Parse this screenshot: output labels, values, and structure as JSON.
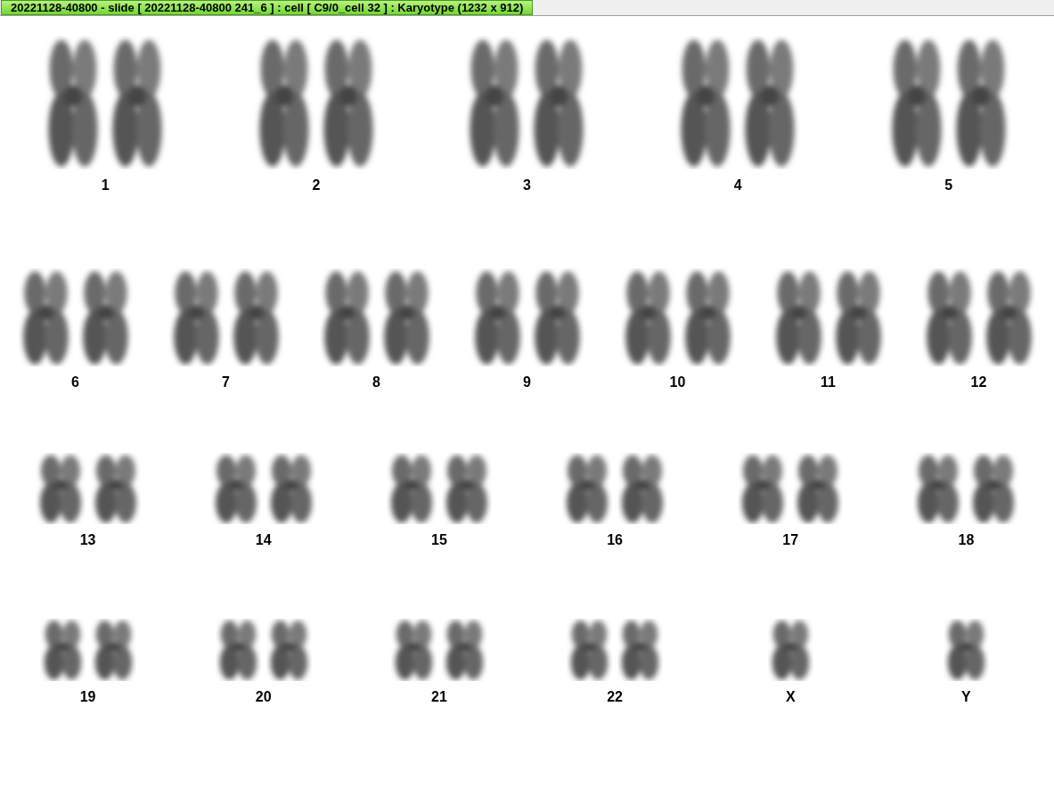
{
  "window": {
    "title": "20221128-40800 - slide [ 20221128-40800 241_6 ] : cell [ C9/0_cell 32 ] : Karyotype  (1232 x 912)"
  },
  "karyotype": {
    "rows": [
      {
        "kind": "large",
        "groups": [
          {
            "label": "1",
            "kind": "pair"
          },
          {
            "label": "2",
            "kind": "pair"
          },
          {
            "label": "3",
            "kind": "pair"
          },
          {
            "label": "4",
            "kind": "pair"
          },
          {
            "label": "5",
            "kind": "pair"
          }
        ]
      },
      {
        "kind": "medium",
        "groups": [
          {
            "label": "6",
            "kind": "pair"
          },
          {
            "label": "7",
            "kind": "pair"
          },
          {
            "label": "8",
            "kind": "pair"
          },
          {
            "label": "9",
            "kind": "pair"
          },
          {
            "label": "10",
            "kind": "pair"
          },
          {
            "label": "11",
            "kind": "pair"
          },
          {
            "label": "12",
            "kind": "pair"
          }
        ]
      },
      {
        "kind": "small",
        "groups": [
          {
            "label": "13",
            "kind": "pair"
          },
          {
            "label": "14",
            "kind": "pair"
          },
          {
            "label": "15",
            "kind": "pair"
          },
          {
            "label": "16",
            "kind": "pair"
          },
          {
            "label": "17",
            "kind": "pair"
          },
          {
            "label": "18",
            "kind": "pair"
          }
        ]
      },
      {
        "kind": "tiny",
        "groups": [
          {
            "label": "19",
            "kind": "pair"
          },
          {
            "label": "20",
            "kind": "pair"
          },
          {
            "label": "21",
            "kind": "pair"
          },
          {
            "label": "22",
            "kind": "pair"
          },
          {
            "label": "X",
            "kind": "single"
          },
          {
            "label": "Y",
            "kind": "single"
          }
        ]
      }
    ]
  }
}
